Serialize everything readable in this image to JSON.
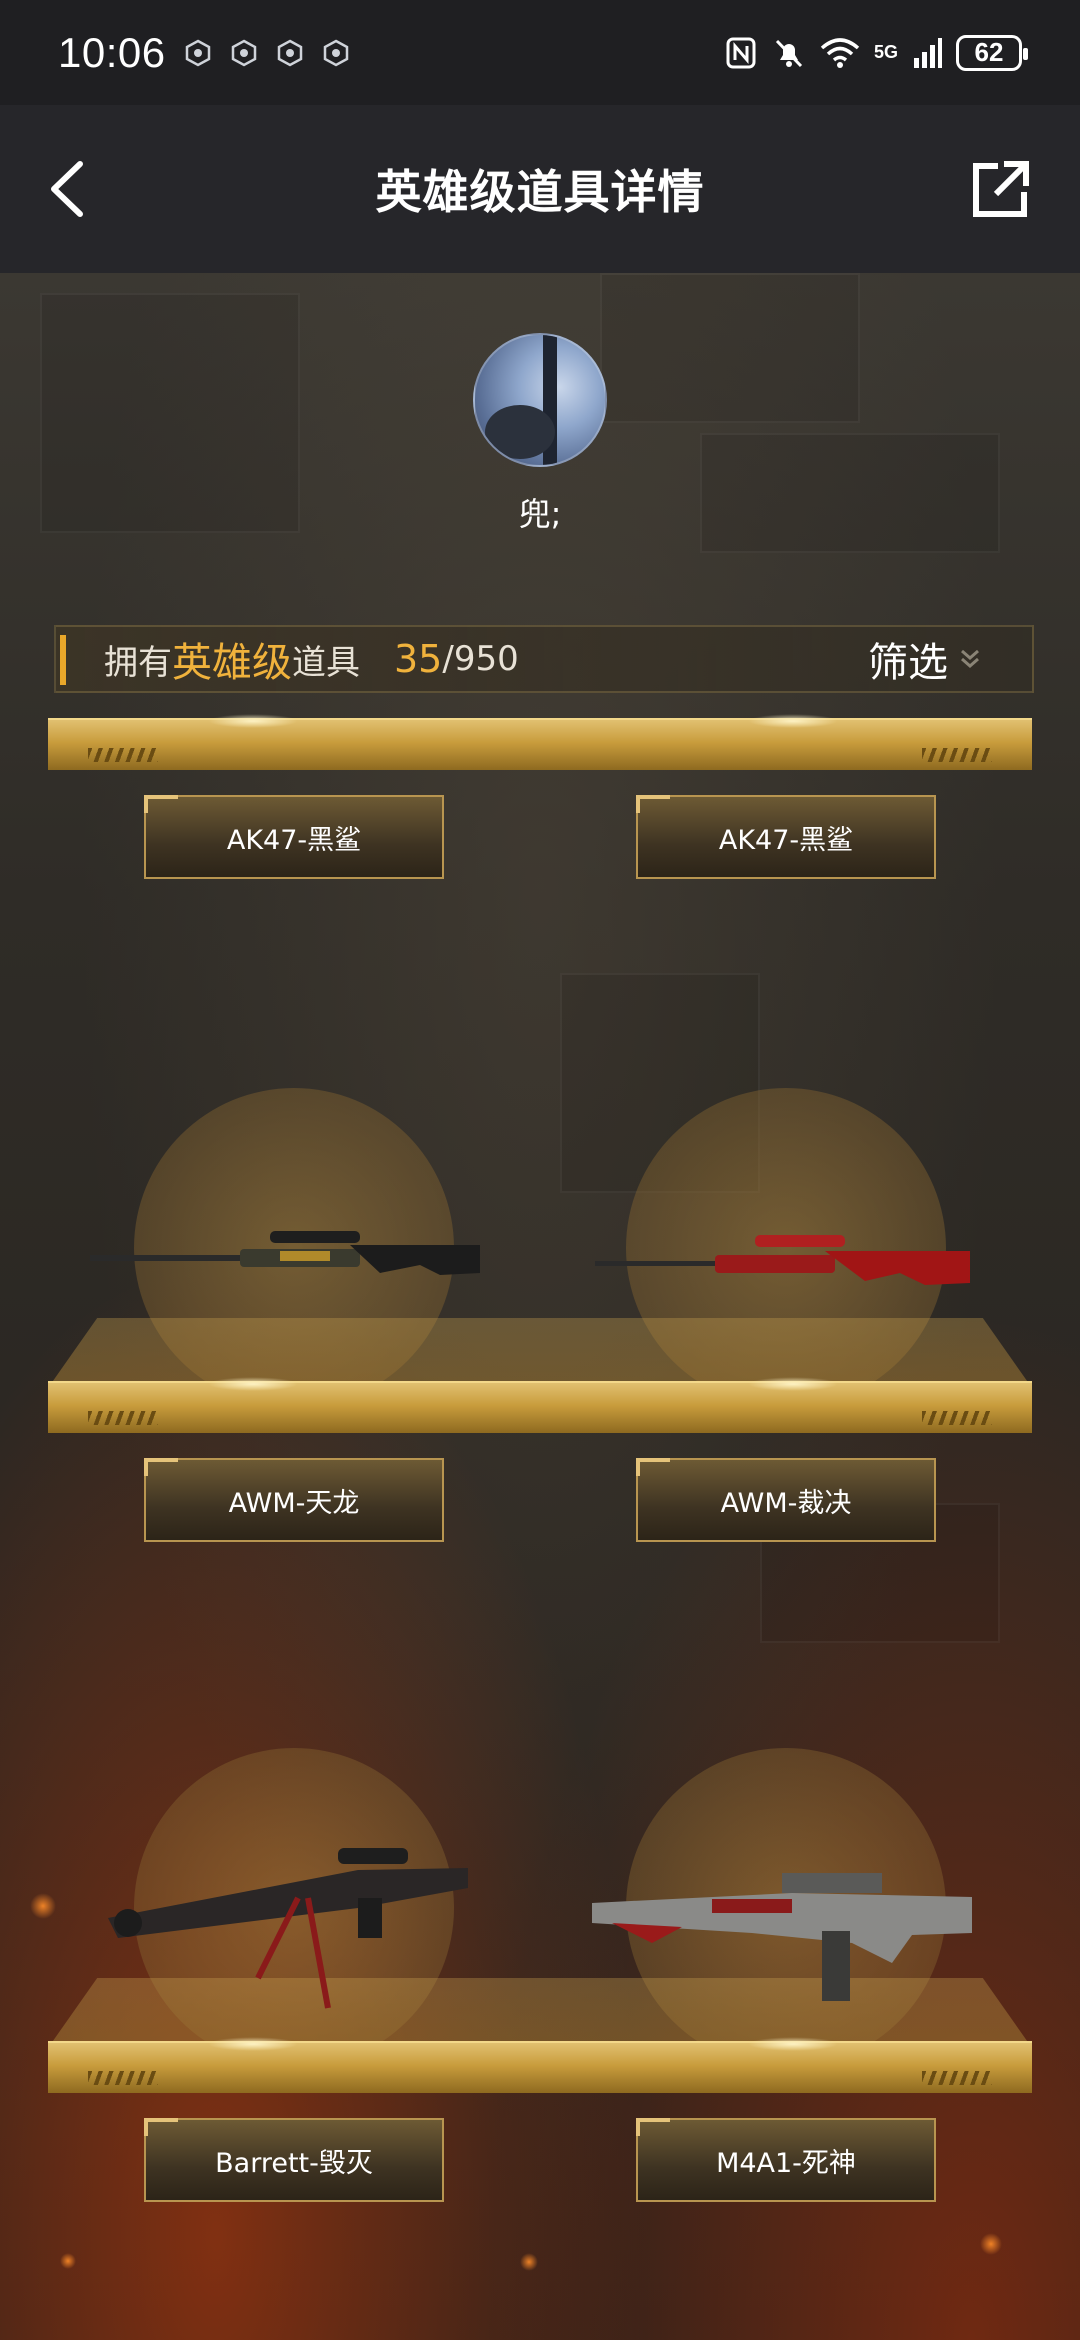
{
  "status_bar": {
    "time": "10:06",
    "network_label": "5G",
    "battery_level": "62"
  },
  "header": {
    "title": "英雄级道具详情",
    "back_icon": "chevron-left-icon",
    "share_icon": "share-external-icon"
  },
  "profile": {
    "username": "兜;"
  },
  "owned_bar": {
    "prefix": "拥有",
    "highlight": "英雄级",
    "suffix": "道具",
    "count": "35",
    "total": "/950",
    "filter_label": "筛选"
  },
  "items": [
    {
      "name": "AK47-黑鲨"
    },
    {
      "name": "AK47-黑鲨"
    },
    {
      "name": "AWM-天龙"
    },
    {
      "name": "AWM-裁决"
    },
    {
      "name": "Barrett-毁灭"
    },
    {
      "name": "M4A1-死神"
    }
  ],
  "colors": {
    "accent_gold": "#f0b23c",
    "header_bg": "#26262a",
    "status_bg": "#1f1f22"
  }
}
